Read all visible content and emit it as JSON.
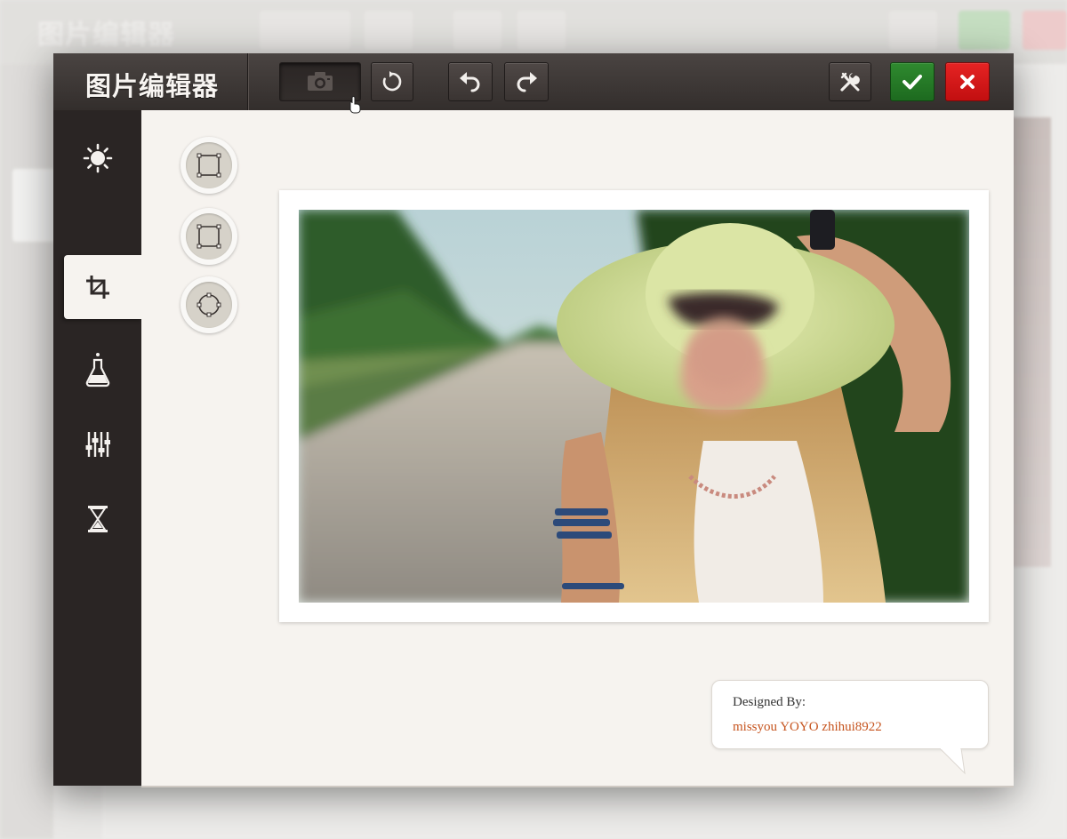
{
  "app": {
    "title": "图片编辑器"
  },
  "toolbar": {
    "buttons": [
      {
        "name": "camera",
        "icon": "camera-icon",
        "state": "pressed"
      },
      {
        "name": "rotate",
        "icon": "rotate-icon"
      },
      {
        "name": "undo",
        "icon": "undo-icon"
      },
      {
        "name": "redo",
        "icon": "redo-icon"
      },
      {
        "name": "settings",
        "icon": "tools-icon"
      },
      {
        "name": "confirm",
        "icon": "check-icon",
        "color": "#1f7a22"
      },
      {
        "name": "cancel",
        "icon": "close-icon",
        "color": "#d91a1a"
      }
    ]
  },
  "sidebar": {
    "items": [
      {
        "name": "brightness",
        "icon": "sun-icon"
      },
      {
        "name": "crop",
        "icon": "crop-icon",
        "active": true
      },
      {
        "name": "effects",
        "icon": "flask-icon"
      },
      {
        "name": "adjust",
        "icon": "sliders-icon"
      },
      {
        "name": "timer",
        "icon": "hourglass-icon"
      }
    ]
  },
  "crop_shapes": [
    {
      "name": "square",
      "icon": "crop-square-icon"
    },
    {
      "name": "rounded-square",
      "icon": "crop-rounded-square-icon"
    },
    {
      "name": "circle",
      "icon": "crop-circle-icon"
    }
  ],
  "credit": {
    "label": "Designed By:",
    "names": "missyou YOYO zhihui8922"
  },
  "colors": {
    "topbar": "#3a3432",
    "sidebar": "#2a2524",
    "canvas": "#f6f3ef",
    "confirm": "#1f7a22",
    "cancel": "#d91a1a",
    "credit_names": "#c6541e"
  }
}
